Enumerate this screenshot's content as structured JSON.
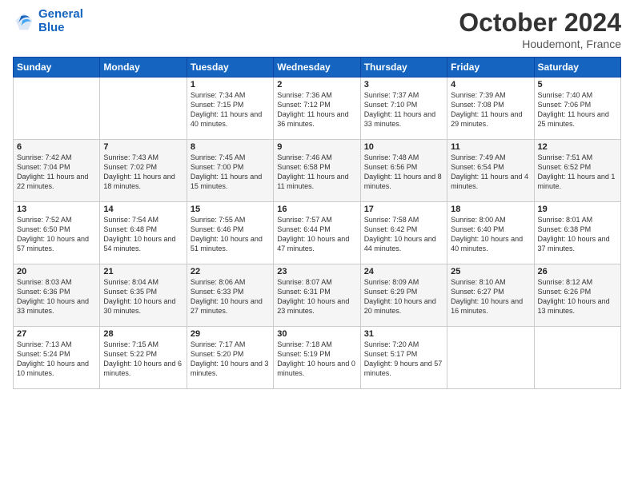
{
  "header": {
    "logo_line1": "General",
    "logo_line2": "Blue",
    "month": "October 2024",
    "location": "Houdemont, France"
  },
  "weekdays": [
    "Sunday",
    "Monday",
    "Tuesday",
    "Wednesday",
    "Thursday",
    "Friday",
    "Saturday"
  ],
  "weeks": [
    [
      {
        "day": "",
        "info": ""
      },
      {
        "day": "",
        "info": ""
      },
      {
        "day": "1",
        "info": "Sunrise: 7:34 AM\nSunset: 7:15 PM\nDaylight: 11 hours and 40 minutes."
      },
      {
        "day": "2",
        "info": "Sunrise: 7:36 AM\nSunset: 7:12 PM\nDaylight: 11 hours and 36 minutes."
      },
      {
        "day": "3",
        "info": "Sunrise: 7:37 AM\nSunset: 7:10 PM\nDaylight: 11 hours and 33 minutes."
      },
      {
        "day": "4",
        "info": "Sunrise: 7:39 AM\nSunset: 7:08 PM\nDaylight: 11 hours and 29 minutes."
      },
      {
        "day": "5",
        "info": "Sunrise: 7:40 AM\nSunset: 7:06 PM\nDaylight: 11 hours and 25 minutes."
      }
    ],
    [
      {
        "day": "6",
        "info": "Sunrise: 7:42 AM\nSunset: 7:04 PM\nDaylight: 11 hours and 22 minutes."
      },
      {
        "day": "7",
        "info": "Sunrise: 7:43 AM\nSunset: 7:02 PM\nDaylight: 11 hours and 18 minutes."
      },
      {
        "day": "8",
        "info": "Sunrise: 7:45 AM\nSunset: 7:00 PM\nDaylight: 11 hours and 15 minutes."
      },
      {
        "day": "9",
        "info": "Sunrise: 7:46 AM\nSunset: 6:58 PM\nDaylight: 11 hours and 11 minutes."
      },
      {
        "day": "10",
        "info": "Sunrise: 7:48 AM\nSunset: 6:56 PM\nDaylight: 11 hours and 8 minutes."
      },
      {
        "day": "11",
        "info": "Sunrise: 7:49 AM\nSunset: 6:54 PM\nDaylight: 11 hours and 4 minutes."
      },
      {
        "day": "12",
        "info": "Sunrise: 7:51 AM\nSunset: 6:52 PM\nDaylight: 11 hours and 1 minute."
      }
    ],
    [
      {
        "day": "13",
        "info": "Sunrise: 7:52 AM\nSunset: 6:50 PM\nDaylight: 10 hours and 57 minutes."
      },
      {
        "day": "14",
        "info": "Sunrise: 7:54 AM\nSunset: 6:48 PM\nDaylight: 10 hours and 54 minutes."
      },
      {
        "day": "15",
        "info": "Sunrise: 7:55 AM\nSunset: 6:46 PM\nDaylight: 10 hours and 51 minutes."
      },
      {
        "day": "16",
        "info": "Sunrise: 7:57 AM\nSunset: 6:44 PM\nDaylight: 10 hours and 47 minutes."
      },
      {
        "day": "17",
        "info": "Sunrise: 7:58 AM\nSunset: 6:42 PM\nDaylight: 10 hours and 44 minutes."
      },
      {
        "day": "18",
        "info": "Sunrise: 8:00 AM\nSunset: 6:40 PM\nDaylight: 10 hours and 40 minutes."
      },
      {
        "day": "19",
        "info": "Sunrise: 8:01 AM\nSunset: 6:38 PM\nDaylight: 10 hours and 37 minutes."
      }
    ],
    [
      {
        "day": "20",
        "info": "Sunrise: 8:03 AM\nSunset: 6:36 PM\nDaylight: 10 hours and 33 minutes."
      },
      {
        "day": "21",
        "info": "Sunrise: 8:04 AM\nSunset: 6:35 PM\nDaylight: 10 hours and 30 minutes."
      },
      {
        "day": "22",
        "info": "Sunrise: 8:06 AM\nSunset: 6:33 PM\nDaylight: 10 hours and 27 minutes."
      },
      {
        "day": "23",
        "info": "Sunrise: 8:07 AM\nSunset: 6:31 PM\nDaylight: 10 hours and 23 minutes."
      },
      {
        "day": "24",
        "info": "Sunrise: 8:09 AM\nSunset: 6:29 PM\nDaylight: 10 hours and 20 minutes."
      },
      {
        "day": "25",
        "info": "Sunrise: 8:10 AM\nSunset: 6:27 PM\nDaylight: 10 hours and 16 minutes."
      },
      {
        "day": "26",
        "info": "Sunrise: 8:12 AM\nSunset: 6:26 PM\nDaylight: 10 hours and 13 minutes."
      }
    ],
    [
      {
        "day": "27",
        "info": "Sunrise: 7:13 AM\nSunset: 5:24 PM\nDaylight: 10 hours and 10 minutes."
      },
      {
        "day": "28",
        "info": "Sunrise: 7:15 AM\nSunset: 5:22 PM\nDaylight: 10 hours and 6 minutes."
      },
      {
        "day": "29",
        "info": "Sunrise: 7:17 AM\nSunset: 5:20 PM\nDaylight: 10 hours and 3 minutes."
      },
      {
        "day": "30",
        "info": "Sunrise: 7:18 AM\nSunset: 5:19 PM\nDaylight: 10 hours and 0 minutes."
      },
      {
        "day": "31",
        "info": "Sunrise: 7:20 AM\nSunset: 5:17 PM\nDaylight: 9 hours and 57 minutes."
      },
      {
        "day": "",
        "info": ""
      },
      {
        "day": "",
        "info": ""
      }
    ]
  ]
}
